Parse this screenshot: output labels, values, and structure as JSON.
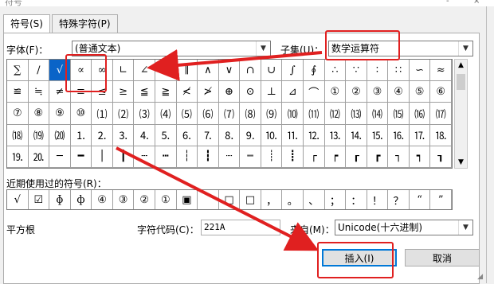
{
  "window": {
    "title": "符号",
    "min_glyph": "-",
    "close_glyph": "×"
  },
  "tabs": [
    {
      "label": "符号(S)"
    },
    {
      "label": "特殊字符(P)"
    }
  ],
  "font": {
    "label": "字体(F)：",
    "value": "(普通文本)"
  },
  "subset": {
    "label": "子集(U)：",
    "value": "数学运算符"
  },
  "grid": [
    [
      "∑",
      "∕",
      "√",
      "∝",
      "∞",
      "∟",
      "∠",
      "∣",
      "∥",
      "∧",
      "∨",
      "∩",
      "∪",
      "∫",
      "∮",
      "∴",
      "∵",
      "∶",
      "∷",
      "∽",
      "≈"
    ],
    [
      "≌",
      "≒",
      "≠",
      "≡",
      "≤",
      "≥",
      "≦",
      "≧",
      "≮",
      "≯",
      "⊕",
      "⊙",
      "⊥",
      "⊿",
      "⌒",
      "①",
      "②",
      "③",
      "④",
      "⑤",
      "⑥"
    ],
    [
      "⑦",
      "⑧",
      "⑨",
      "⑩",
      "⑴",
      "⑵",
      "⑶",
      "⑷",
      "⑸",
      "⑹",
      "⑺",
      "⑻",
      "⑼",
      "⑽",
      "⑾",
      "⑿",
      "⒀",
      "⒁",
      "⒂",
      "⒃",
      "⒄"
    ],
    [
      "⒅",
      "⒆",
      "⒇",
      "⒈",
      "⒉",
      "⒊",
      "⒋",
      "⒌",
      "⒍",
      "⒎",
      "⒏",
      "⒐",
      "⒑",
      "⒒",
      "⒓",
      "⒔",
      "⒕",
      "⒖",
      "⒗",
      "⒘",
      "⒙"
    ],
    [
      "⒚",
      "⒛",
      "─",
      "━",
      "│",
      "┃",
      "┄",
      "┅",
      "┆",
      "┇",
      "┈",
      "┉",
      "┊",
      "┋",
      "┌",
      "┍",
      "┎",
      "┏",
      "┐",
      "┑",
      "┒"
    ]
  ],
  "recent": {
    "label": "近期使用过的符号(R)：",
    "items": [
      "√",
      "☑",
      "ɸ",
      "ф",
      "④",
      "③",
      "②",
      "①",
      "▣",
      "",
      "□",
      "□",
      "，",
      "。",
      "、",
      "；",
      "：",
      "！",
      "？",
      "“",
      "”"
    ]
  },
  "unicode_name": "平方根",
  "charcode": {
    "label": "字符代码(C)：",
    "value": "221A"
  },
  "from": {
    "label": "来自(M)：",
    "value": "Unicode(十六进制)"
  },
  "buttons": {
    "insert": "插入(I)",
    "cancel": "取消"
  },
  "annotations": {
    "color": "#e02020"
  }
}
